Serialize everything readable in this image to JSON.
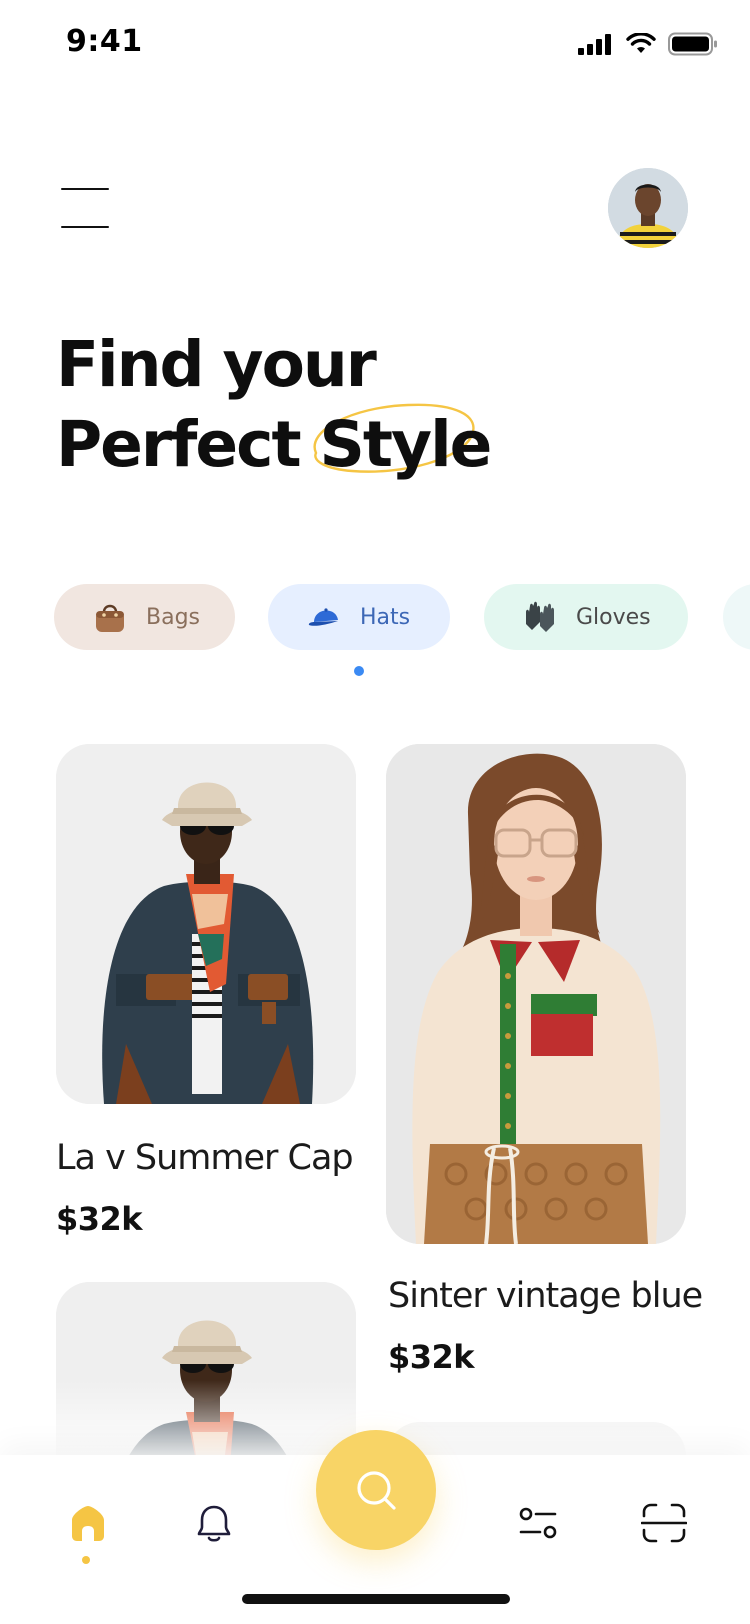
{
  "status_bar": {
    "time": "9:41",
    "icons": [
      "cellular-signal-icon",
      "wifi-icon",
      "battery-icon"
    ]
  },
  "header": {
    "menu_icon": "hamburger-menu-icon",
    "avatar_icon": "user-avatar"
  },
  "title": {
    "line1": "Find your",
    "line2_prefix": "Perfect",
    "line2_highlight": "Style",
    "highlight_color": "#f5c544"
  },
  "categories": [
    {
      "label": "Bags",
      "icon": "handbag-icon",
      "bg": "#f1e6e0"
    },
    {
      "label": "Hats",
      "icon": "cap-icon",
      "bg": "#e6efff"
    },
    {
      "label": "Gloves",
      "icon": "gloves-icon",
      "bg": "#e3f7f0"
    }
  ],
  "active_category_index": 1,
  "products": [
    {
      "name": "La v Summer Cap",
      "price": "$32k",
      "image": "model-bucket-hat-jacket"
    },
    {
      "name": "Sinter vintage blue",
      "price": "$32k",
      "image": "model-collared-blouse"
    },
    {
      "name": "",
      "price": "",
      "image": "model-bucket-hat-jacket"
    }
  ],
  "bottom_nav": {
    "items": [
      "home-icon",
      "bell-icon",
      "search-icon",
      "filter-icon",
      "scan-icon"
    ],
    "active": "home-icon",
    "accent": "#f8d466"
  }
}
